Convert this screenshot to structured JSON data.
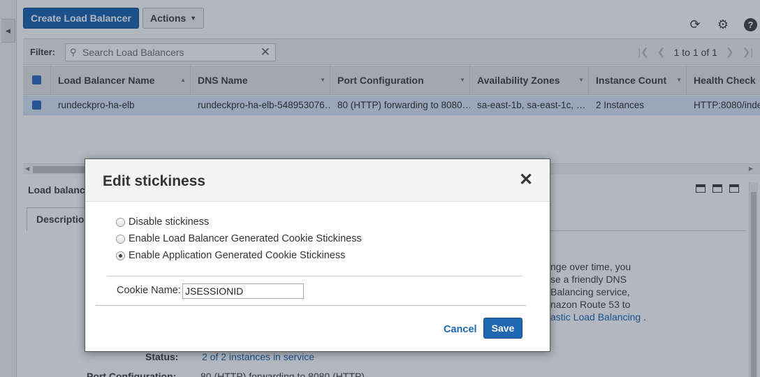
{
  "toolbar": {
    "create_label": "Create Load Balancer",
    "actions_label": "Actions"
  },
  "filter": {
    "label": "Filter:",
    "placeholder": "Search Load Balancers",
    "pager_text": "1 to 1 of 1"
  },
  "table": {
    "columns": [
      "Load Balancer Name",
      "DNS Name",
      "Port Configuration",
      "Availability Zones",
      "Instance Count",
      "Health Check"
    ],
    "rows": [
      {
        "name": "rundeckpro-ha-elb",
        "dns": "rundeckpro-ha-elb-548953076…",
        "port": "80 (HTTP) forwarding to 8080…",
        "zones": "sa-east-1b, sa-east-1c, …",
        "count": "2 Instances",
        "health": "HTTP:8080/inde"
      }
    ]
  },
  "details": {
    "title": "Load balanc",
    "tab_label": "Descriptio",
    "desc_lines": [
      "nge over time, you",
      "se a friendly DNS",
      " Balancing service,",
      "nazon Route 53 to"
    ],
    "desc_link": "astic Load Balancing",
    "desc_tail": ".",
    "status_key": "Status:",
    "status_value": "2 of 2 instances in service",
    "port_key": "Port Configuration:",
    "port_value": "80 (HTTP) forwarding to 8080 (HTTP)"
  },
  "modal": {
    "title": "Edit stickiness",
    "options": [
      {
        "label": "Disable stickiness",
        "checked": false
      },
      {
        "label": "Enable Load Balancer Generated Cookie Stickiness",
        "checked": false
      },
      {
        "label": "Enable Application Generated Cookie Stickiness",
        "checked": true
      }
    ],
    "cookie_label": "Cookie Name:",
    "cookie_value": "JSESSIONID",
    "cancel_label": "Cancel",
    "save_label": "Save"
  },
  "colors": {
    "accent": "#1f67b1",
    "selected_row": "#d9e6f3"
  },
  "icons": [
    "search-icon",
    "clear-icon",
    "refresh-icon",
    "gear-icon",
    "help-icon",
    "close-icon"
  ]
}
